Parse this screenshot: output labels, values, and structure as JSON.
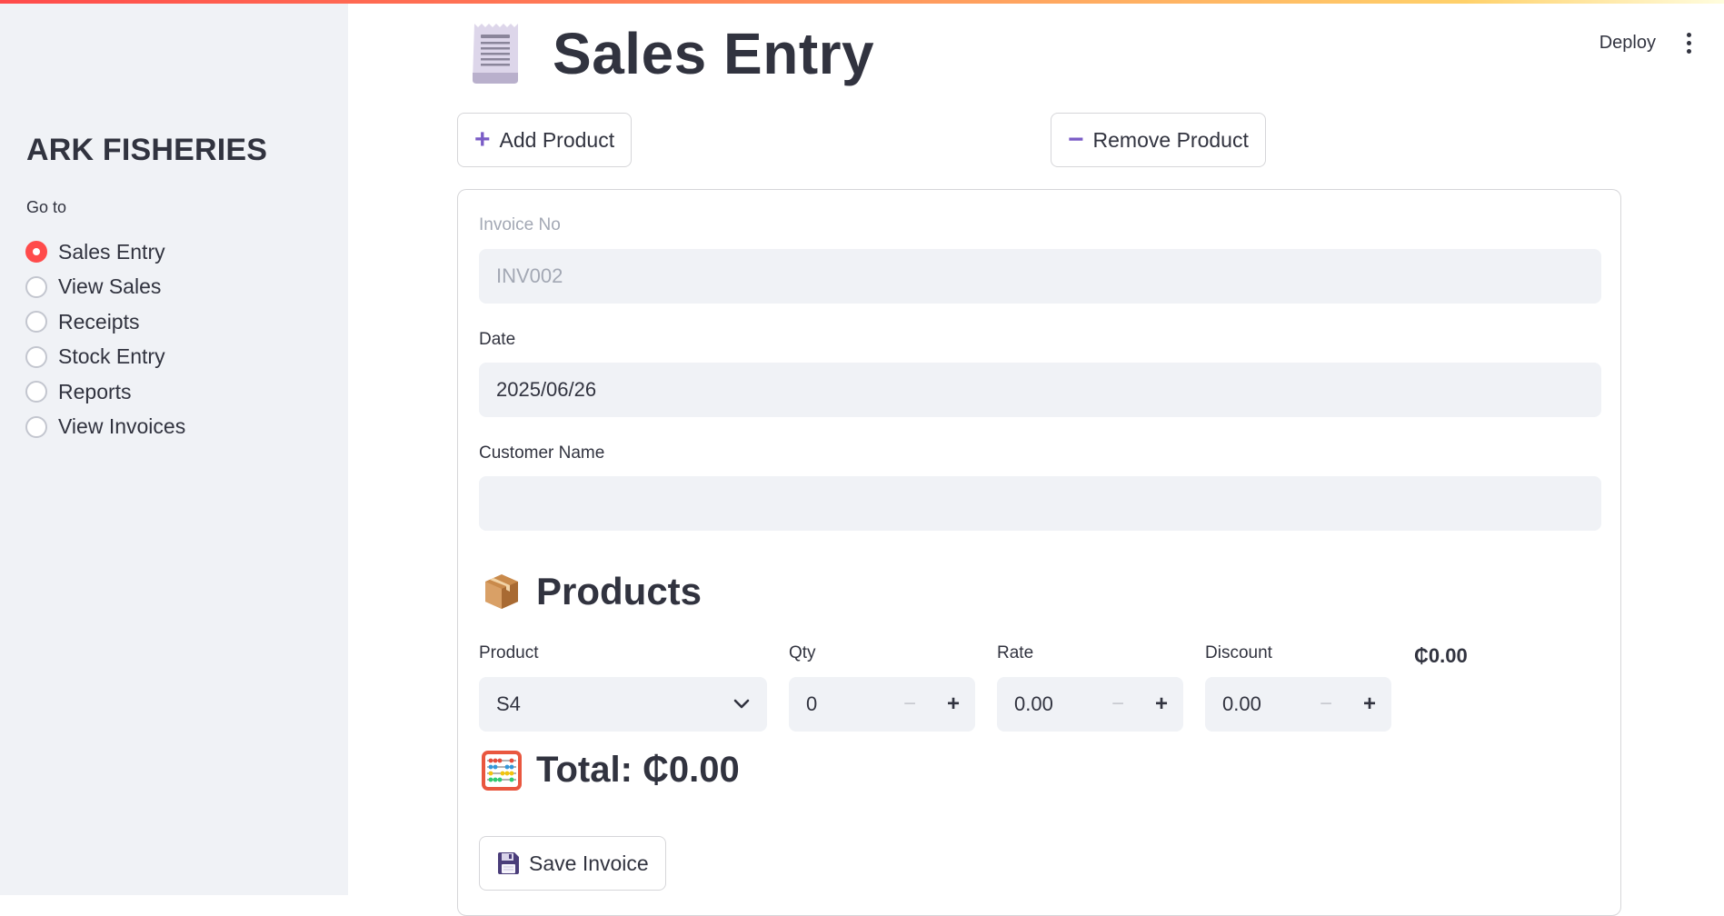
{
  "app": {
    "brand": "ARK FISHERIES",
    "deploy_label": "Deploy",
    "accent_color": "#ff4b4b",
    "icon_color": "#7a5cc6"
  },
  "sidebar": {
    "goto_label": "Go to",
    "items": [
      {
        "label": "Sales Entry",
        "selected": true
      },
      {
        "label": "View Sales",
        "selected": false
      },
      {
        "label": "Receipts",
        "selected": false
      },
      {
        "label": "Stock Entry",
        "selected": false
      },
      {
        "label": "Reports",
        "selected": false
      },
      {
        "label": "View Invoices",
        "selected": false
      }
    ]
  },
  "page": {
    "title": "Sales Entry",
    "title_icon": "receipt-icon",
    "add_product_label": "Add Product",
    "remove_product_label": "Remove Product"
  },
  "form": {
    "invoice_label": "Invoice No",
    "invoice_value": "INV002",
    "date_label": "Date",
    "date_value": "2025/06/26",
    "customer_label": "Customer Name",
    "customer_value": "",
    "products_heading": "Products",
    "products_icon": "package-icon",
    "columns": {
      "product": "Product",
      "qty": "Qty",
      "rate": "Rate",
      "discount": "Discount"
    },
    "row": {
      "product": "S4",
      "qty": "0",
      "rate": "0.00",
      "discount": "0.00",
      "amount": "₵0.00"
    },
    "total_text": "Total: ₵0.00",
    "total_icon": "abacus-icon",
    "save_label": "Save Invoice",
    "save_icon": "floppy-disk-icon"
  }
}
